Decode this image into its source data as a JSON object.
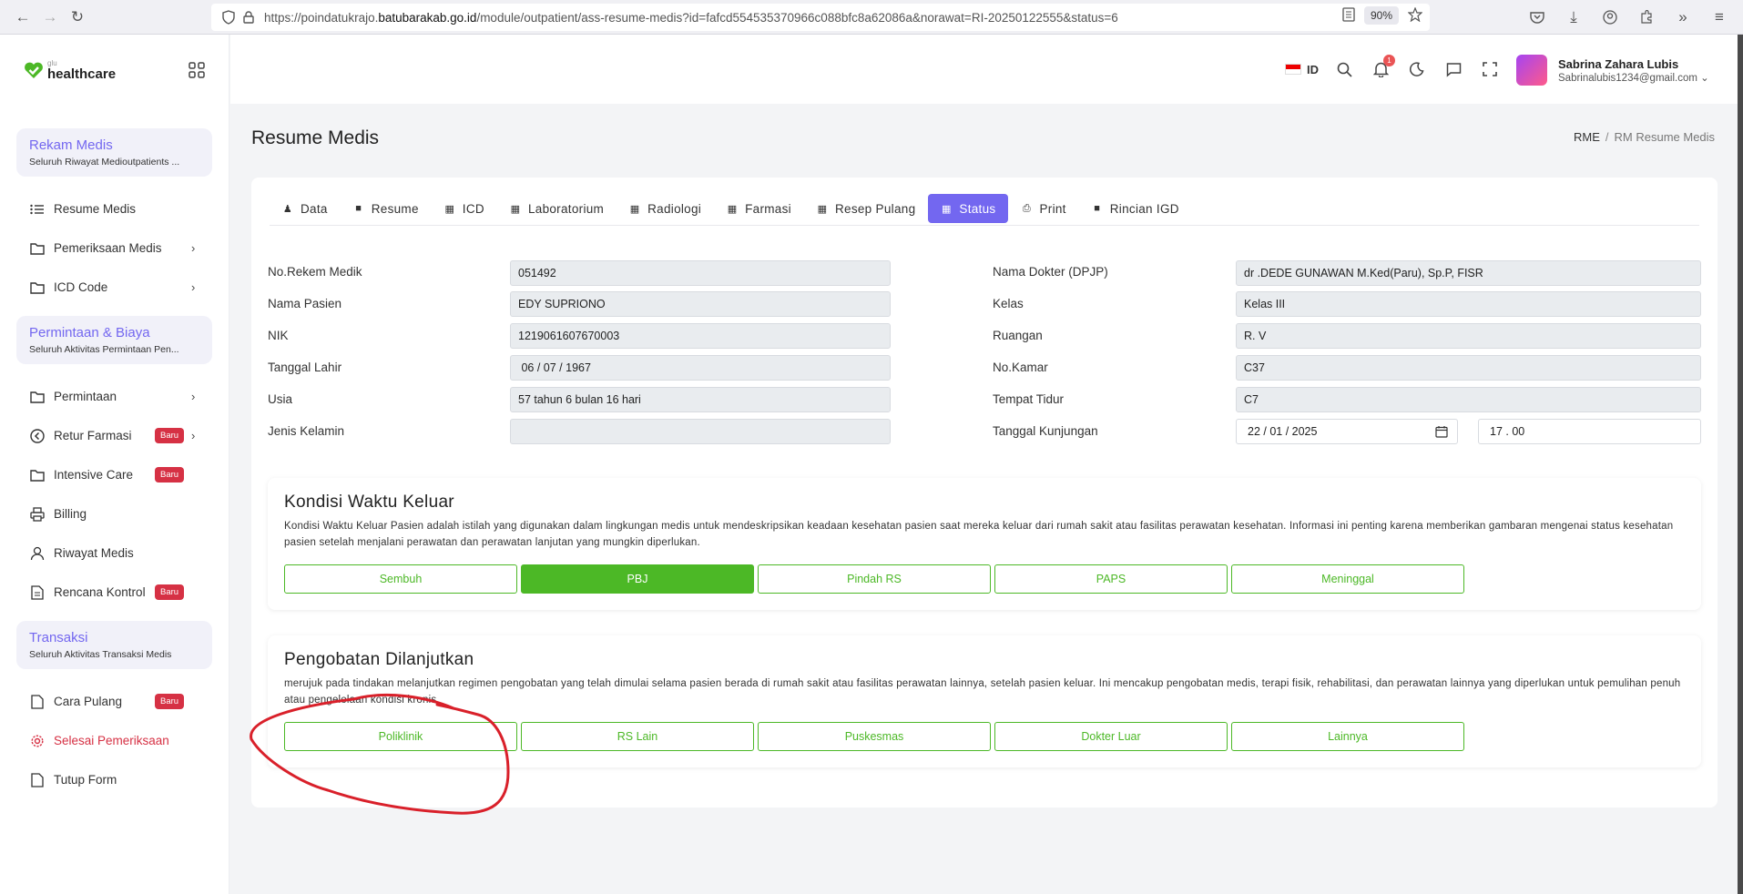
{
  "browser": {
    "url_prefix": "https://poindatukrajo.",
    "url_domain": "batubarakab.go.id",
    "url_path": "/module/outpatient/ass-resume-medis?id=fafcd554535370966c088bfc8a62086a&norawat=RI-20250122555&status=6",
    "zoom": "90%"
  },
  "sidebar": {
    "logo_small": "glu",
    "logo_big": "healthcare",
    "groups": [
      {
        "title": "Rekam Medis",
        "subtitle": "Seluruh Riwayat Medioutpatients ..."
      },
      {
        "title": "Permintaan & Biaya",
        "subtitle": "Seluruh Aktivitas Permintaan Pen..."
      },
      {
        "title": "Transaksi",
        "subtitle": "Seluruh Aktivitas Transaksi Medis"
      }
    ],
    "items": {
      "resume_medis": "Resume Medis",
      "pemeriksaan_medis": "Pemeriksaan Medis",
      "icd_code": "ICD Code",
      "permintaan": "Permintaan",
      "retur_farmasi": "Retur Farmasi",
      "intensive_care": "Intensive Care",
      "billing": "Billing",
      "riwayat_medis": "Riwayat Medis",
      "rencana_kontrol": "Rencana Kontrol",
      "cara_pulang": "Cara Pulang",
      "selesai_pemeriksaan": "Selesai Pemeriksaan",
      "tutup_form": "Tutup Form"
    },
    "badge": "Baru"
  },
  "header": {
    "lang": "ID",
    "notif_count": "1",
    "user_name": "Sabrina Zahara Lubis",
    "user_email": "Sabrinalubis1234@gmail.com"
  },
  "page": {
    "title": "Resume Medis",
    "breadcrumb_root": "RME",
    "breadcrumb_sep": "/",
    "breadcrumb_current": "RM Resume Medis"
  },
  "tabs": [
    "Data",
    "Resume",
    "ICD",
    "Laboratorium",
    "Radiologi",
    "Farmasi",
    "Resep Pulang",
    "Status",
    "Print",
    "Rincian IGD"
  ],
  "active_tab": "Status",
  "form": {
    "left": [
      {
        "label": "No.Rekem Medik",
        "value": "051492"
      },
      {
        "label": "Nama Pasien",
        "value": "EDY SUPRIONO"
      },
      {
        "label": "NIK",
        "value": "1219061607670003"
      },
      {
        "label": "Tanggal Lahir",
        "value": " 06 / 07 / 1967"
      },
      {
        "label": "Usia",
        "value": "57 tahun 6 bulan 16 hari"
      },
      {
        "label": "Jenis Kelamin",
        "value": ""
      }
    ],
    "right": [
      {
        "label": "Nama Dokter (DPJP)",
        "value": "dr .DEDE GUNAWAN M.Ked(Paru), Sp.P, FISR"
      },
      {
        "label": "Kelas",
        "value": "Kelas III"
      },
      {
        "label": "Ruangan",
        "value": "R. V"
      },
      {
        "label": "No.Kamar",
        "value": "C37"
      },
      {
        "label": "Tempat Tidur",
        "value": "C7"
      },
      {
        "label": "Tanggal Kunjungan",
        "value": "22 / 01 / 2025",
        "time": "17 . 00"
      }
    ]
  },
  "kondisi": {
    "title": "Kondisi Waktu Keluar",
    "desc": "Kondisi Waktu Keluar Pasien adalah istilah yang digunakan dalam lingkungan medis untuk mendeskripsikan keadaan kesehatan pasien saat mereka keluar dari rumah sakit atau fasilitas perawatan kesehatan. Informasi ini penting karena memberikan gambaran mengenai status kesehatan pasien setelah menjalani perawatan dan perawatan lanjutan yang mungkin diperlukan.",
    "options": [
      "Sembuh",
      "PBJ",
      "Pindah RS",
      "PAPS",
      "Meninggal"
    ],
    "selected": "PBJ"
  },
  "pengobatan": {
    "title": "Pengobatan Dilanjutkan",
    "desc": "merujuk pada tindakan melanjutkan regimen pengobatan yang telah dimulai selama pasien berada di rumah sakit atau fasilitas perawatan lainnya, setelah pasien keluar. Ini mencakup pengobatan medis, terapi fisik, rehabilitasi, dan perawatan lainnya yang diperlukan untuk pemulihan penuh atau pengelolaan kondisi kronis.",
    "options": [
      "Poliklinik",
      "RS Lain",
      "Puskesmas",
      "Dokter Luar",
      "Lainnya"
    ]
  },
  "colors": {
    "accent": "#7367f0",
    "green": "#4cb826",
    "danger": "#d63144",
    "annotation": "#d9202a"
  }
}
